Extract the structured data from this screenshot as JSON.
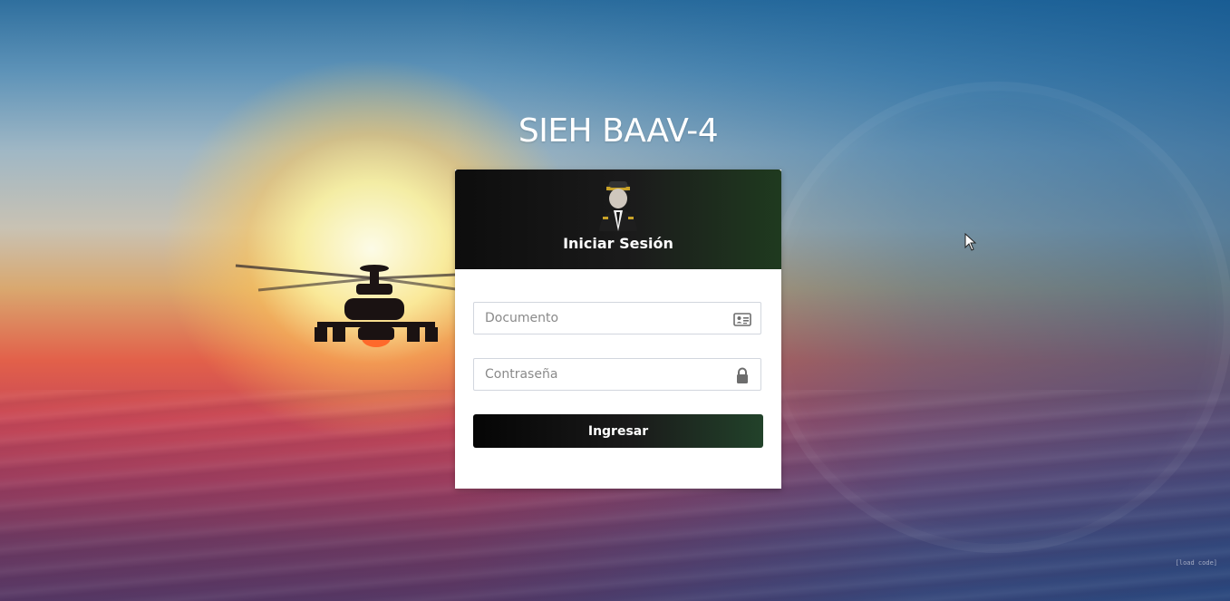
{
  "app": {
    "title": "SIEH BAAV-4"
  },
  "login": {
    "title": "Iniciar Sesión",
    "document_placeholder": "Documento",
    "password_placeholder": "Contraseña",
    "submit_label": "Ingresar"
  },
  "footer": {
    "code": "[load code]"
  },
  "icons": {
    "document": "id-card-icon",
    "password": "lock-icon",
    "avatar": "officer-avatar-icon"
  },
  "colors": {
    "header_dark": "#111111",
    "header_accent": "#1f3a1f",
    "title_text": "#ffffff"
  }
}
